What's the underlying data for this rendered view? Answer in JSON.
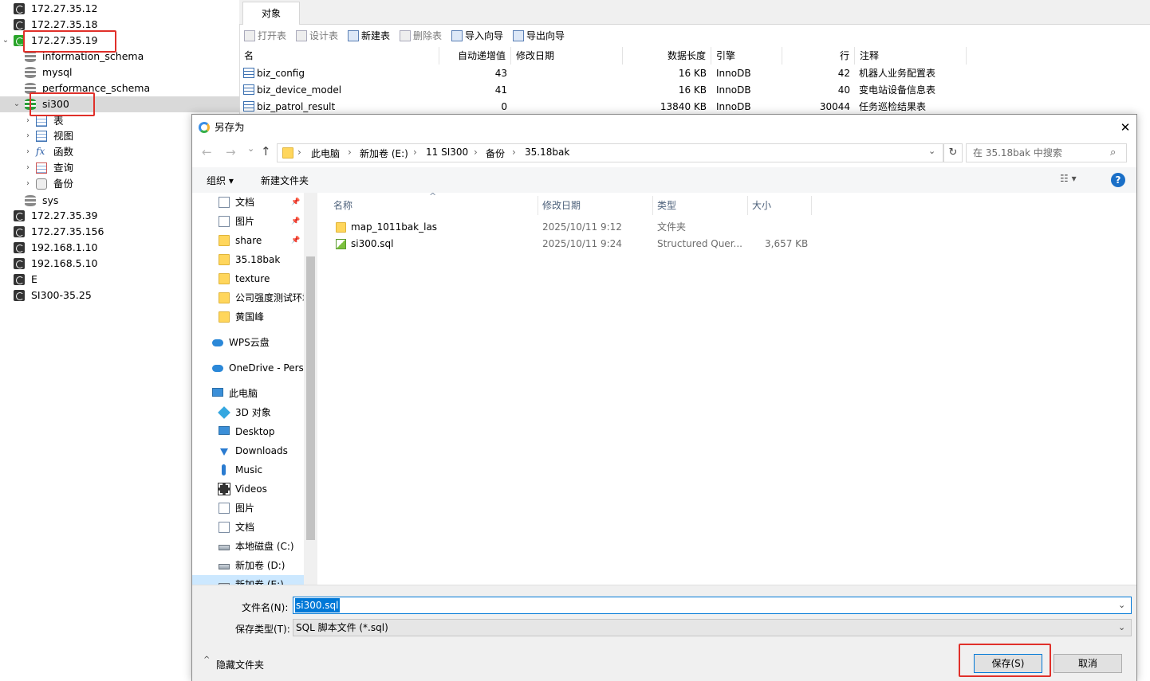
{
  "tree": {
    "rows": [
      {
        "label": "172.27.35.12"
      },
      {
        "label": "172.27.35.18"
      },
      {
        "label": "172.27.35.19"
      },
      {
        "label": "information_schema"
      },
      {
        "label": "mysql"
      },
      {
        "label": "performance_schema"
      },
      {
        "label": "si300"
      },
      {
        "label": "表"
      },
      {
        "label": "视图"
      },
      {
        "label": "函数"
      },
      {
        "label": "查询"
      },
      {
        "label": "备份"
      },
      {
        "label": "sys"
      },
      {
        "label": "172.27.35.39"
      },
      {
        "label": "172.27.35.156"
      },
      {
        "label": "192.168.1.10"
      },
      {
        "label": "192.168.5.10"
      },
      {
        "label": "E"
      },
      {
        "label": "SI300-35.25"
      }
    ],
    "func_glyph": "fx"
  },
  "objects": {
    "tab": "对象",
    "toolbar": [
      "打开表",
      "设计表",
      "新建表",
      "删除表",
      "导入向导",
      "导出向导"
    ],
    "columns": [
      "名",
      "自动递增值",
      "修改日期",
      "数据长度",
      "引擎",
      "行",
      "注释"
    ],
    "rows": [
      {
        "name": "biz_config",
        "auto_inc": "43",
        "date": "",
        "size": "16 KB",
        "engine": "InnoDB",
        "rows": "42",
        "comment": "机器人业务配置表"
      },
      {
        "name": "biz_device_model",
        "auto_inc": "41",
        "date": "",
        "size": "16 KB",
        "engine": "InnoDB",
        "rows": "40",
        "comment": "变电站设备信息表"
      },
      {
        "name": "biz_patrol_result",
        "auto_inc": "0",
        "date": "",
        "size": "13840 KB",
        "engine": "InnoDB",
        "rows": "30044",
        "comment": "任务巡检结果表"
      }
    ]
  },
  "dialog": {
    "title": "另存为",
    "close_glyph": "✕",
    "nav_glyphs": {
      "back": "←",
      "forward": "→",
      "down": "⌄",
      "up": "↑",
      "refresh": "↻",
      "search": "⌕",
      "sep": "›"
    },
    "breadcrumb": [
      "此电脑",
      "新加卷 (E:)",
      "11 SI300",
      "备份",
      "35.18bak"
    ],
    "search_placeholder": "在 35.18bak 中搜索",
    "cmd": {
      "organize": "组织 ▾",
      "new_folder": "新建文件夹",
      "view": "☷ ▾",
      "help": "?"
    },
    "nav_items": [
      {
        "label": "文档",
        "pinned": true
      },
      {
        "label": "图片",
        "pinned": true
      },
      {
        "label": "share",
        "pinned": true
      },
      {
        "label": "35.18bak"
      },
      {
        "label": "texture"
      },
      {
        "label": "公司强度测试环境"
      },
      {
        "label": "黄国峰"
      },
      {
        "label": "WPS云盘"
      },
      {
        "label": "OneDrive - Personal"
      },
      {
        "label": "此电脑"
      },
      {
        "label": "3D 对象"
      },
      {
        "label": "Desktop"
      },
      {
        "label": "Downloads"
      },
      {
        "label": "Music"
      },
      {
        "label": "Videos"
      },
      {
        "label": "图片"
      },
      {
        "label": "文档"
      },
      {
        "label": "本地磁盘 (C:)"
      },
      {
        "label": "新加卷 (D:)"
      },
      {
        "label": "新加卷 (E:)"
      }
    ],
    "pin_glyph": "📌",
    "file_headers": [
      "名称",
      "修改日期",
      "类型",
      "大小"
    ],
    "sort_glyph": "^",
    "files": [
      {
        "name": "map_1011bak_las",
        "date": "2025/10/11 9:12",
        "type": "文件夹",
        "size": ""
      },
      {
        "name": "si300.sql",
        "date": "2025/10/11 9:24",
        "type": "Structured Quer...",
        "size": "3,657 KB"
      }
    ],
    "filename_label": "文件名(N):",
    "filename_value": "si300.sql",
    "filetype_label": "保存类型(T):",
    "filetype_value": "SQL 脚本文件 (*.sql)",
    "hide_folders": "隐藏文件夹",
    "save": "保存(S)",
    "cancel": "取消"
  }
}
